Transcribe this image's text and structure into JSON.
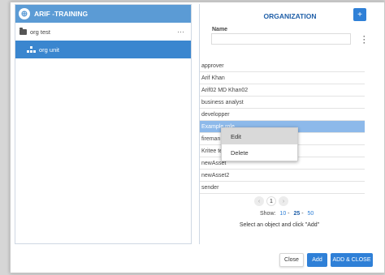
{
  "left": {
    "header_title": "ARIF -TRAINING",
    "tree": [
      {
        "label": "org test"
      },
      {
        "label": "org unit"
      }
    ],
    "more_label": "···"
  },
  "right": {
    "title": "ORGANIZATION",
    "add_label": "+",
    "name_label": "Name",
    "kebab": "⋮",
    "items": [
      "approver",
      "Arif Khan",
      "Arif02 MD Khan02",
      "business analyst",
      "developper",
      "Example role",
      "fireman",
      "Kritee te",
      "newAsset",
      "newAsset2",
      "sender"
    ],
    "context_menu": [
      "Edit",
      "Delete"
    ],
    "pager": {
      "prev": "‹",
      "page": "1",
      "next": "›"
    },
    "show_label": "Show:",
    "show_options": [
      "10",
      "25",
      "50"
    ],
    "show_separator": "-",
    "hint": "Select an object and click \"Add\""
  },
  "footer": {
    "close_label": "Close",
    "add_label": "Add",
    "add_close_label": "ADD & CLOSE"
  },
  "colors": {
    "accent": "#2f80d7",
    "header_blue": "#5b9bd5",
    "selected_row": "#3a86cf",
    "highlight_row": "#8db9ea",
    "title_blue": "#1f5fa8"
  }
}
